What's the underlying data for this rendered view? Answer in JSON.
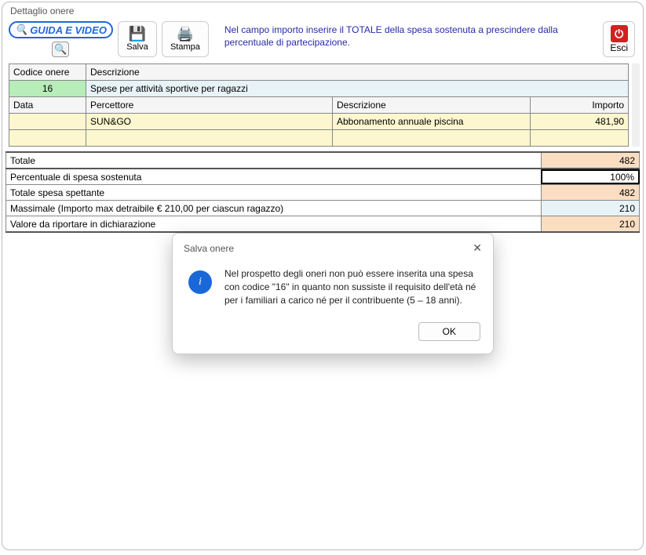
{
  "window": {
    "title": "Dettaglio onere"
  },
  "toolbar": {
    "guida_label": "GUIDA E VIDEO",
    "salva_label": "Salva",
    "stampa_label": "Stampa",
    "esci_label": "Esci",
    "hint": "Nel campo importo inserire il TOTALE della spesa sostenuta a prescindere dalla percentuale di partecipazione."
  },
  "headers": {
    "codice": "Codice onere",
    "descrizione": "Descrizione",
    "data": "Data",
    "percettore": "Percettore",
    "descrizione2": "Descrizione",
    "importo": "Importo"
  },
  "row1": {
    "codice": "16",
    "descrizione": "Spese per attività sportive per ragazzi"
  },
  "row2": {
    "data": "",
    "percettore": "SUN&GO",
    "descrizione": "Abbonamento annuale piscina",
    "importo": "481,90"
  },
  "summary": {
    "totale_label": "Totale",
    "totale_val": "482",
    "perc_label": "Percentuale di spesa sostenuta",
    "perc_val": "100%",
    "spettante_label": "Totale spesa spettante",
    "spettante_val": "482",
    "massimale_label": "Massimale (Importo max detraibile € 210,00 per ciascun ragazzo)",
    "massimale_val": "210",
    "valore_label": "Valore da riportare in dichiarazione",
    "valore_val": "210"
  },
  "dialog": {
    "title": "Salva onere",
    "message": "Nel prospetto degli oneri non può essere inserita una spesa con codice \"16\" in quanto non sussiste il requisito dell'età né per i familiari a carico né per il contribuente (5 – 18 anni).",
    "ok": "OK"
  }
}
